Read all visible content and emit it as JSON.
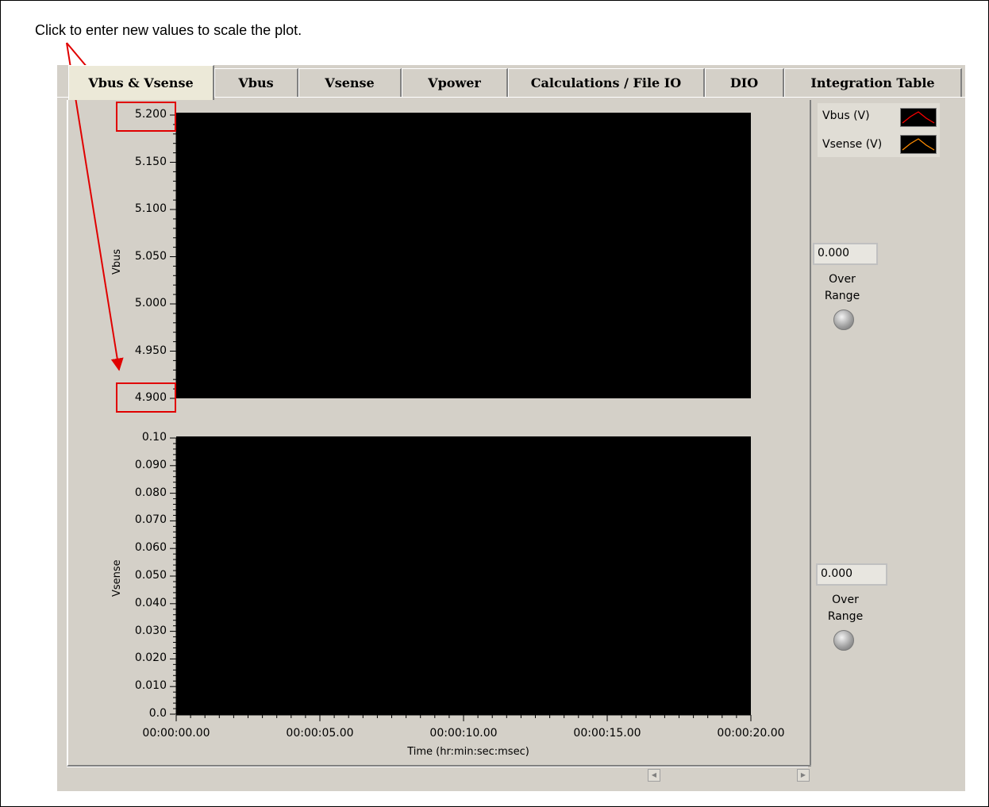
{
  "annotation": {
    "text": "Click to enter new values to scale the plot."
  },
  "tabs": [
    {
      "label": "Vbus & Vsense",
      "active": true
    },
    {
      "label": "Vbus"
    },
    {
      "label": "Vsense"
    },
    {
      "label": "Vpower"
    },
    {
      "label": "Calculations / File IO"
    },
    {
      "label": "DIO"
    },
    {
      "label": "Integration Table"
    }
  ],
  "chart_data": [
    {
      "type": "line",
      "ylabel": "Vbus",
      "xlabel": "",
      "ylim": [
        4.9,
        5.2
      ],
      "y_ticks": [
        "5.200",
        "5.150",
        "5.100",
        "5.050",
        "5.000",
        "4.950",
        "4.900"
      ],
      "background": "#000000",
      "series": []
    },
    {
      "type": "line",
      "ylabel": "Vsense",
      "xlabel": "Time (hr:min:sec:msec)",
      "ylim": [
        0.0,
        0.1
      ],
      "y_ticks": [
        "0.10",
        "0.090",
        "0.080",
        "0.070",
        "0.060",
        "0.050",
        "0.040",
        "0.030",
        "0.020",
        "0.010",
        "0.0"
      ],
      "x_ticks": [
        "00:00:00.00",
        "00:00:05.00",
        "00:00:10.00",
        "00:00:15.00",
        "00:00:20.00"
      ],
      "background": "#000000",
      "series": []
    }
  ],
  "legend": [
    {
      "label": "Vbus (V)",
      "color": "#ff0000"
    },
    {
      "label": "Vsense (V)",
      "color": "#ff8c00"
    }
  ],
  "indicators": [
    {
      "value": "0.000",
      "label_line1": "Over",
      "label_line2": "Range"
    },
    {
      "value": "0.000",
      "label_line1": "Over",
      "label_line2": "Range"
    }
  ],
  "colors": {
    "highlight": "#e00000",
    "panel": "#d4d0c8"
  }
}
